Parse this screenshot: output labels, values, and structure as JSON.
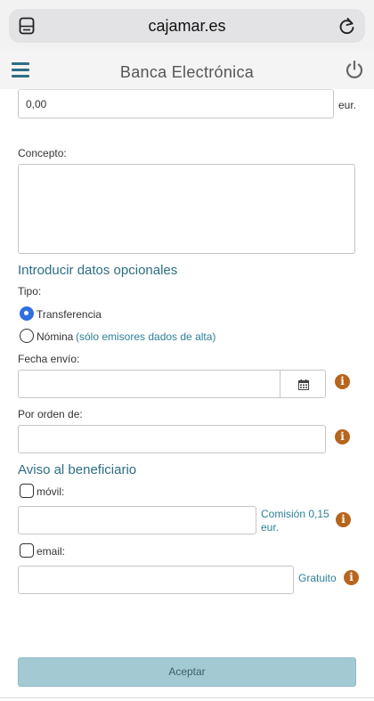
{
  "browser": {
    "url": "cajamar.es"
  },
  "header": {
    "title": "Banca Electrónica"
  },
  "form": {
    "amount_value": "0,00",
    "currency": "eur.",
    "concept_label": "Concepto:",
    "concept_value": "",
    "optional_title": "Introducir datos opcionales",
    "type_label": "Tipo:",
    "type_options": [
      {
        "label": "Transferencia",
        "selected": true
      },
      {
        "label": "Nómina",
        "selected": false
      }
    ],
    "nomina_note": "(sólo emisores dados de alta)",
    "send_date_label": "Fecha envío:",
    "send_date_value": "",
    "order_label": "Por orden de:",
    "order_value": "",
    "notice_title": "Aviso al beneficiario",
    "mobile_label": "móvil:",
    "mobile_checked": false,
    "mobile_value": "",
    "mobile_fee_line1": "Comisión 0,15",
    "mobile_fee_line2": "eur.",
    "email_label": "email:",
    "email_checked": false,
    "email_value": "",
    "email_fee": "Gratuito",
    "submit_label": "Aceptar"
  },
  "colors": {
    "accent": "#2d6e86",
    "info_icon": "#b7651e",
    "radio_selected": "#2f6fe0",
    "submit_bg": "#a3cad3"
  },
  "icons": {
    "tabs": "tabs-icon",
    "reload": "reload-icon",
    "menu": "hamburger-menu-icon",
    "power": "power-icon",
    "calendar": "calendar-icon",
    "info": "info-icon"
  }
}
